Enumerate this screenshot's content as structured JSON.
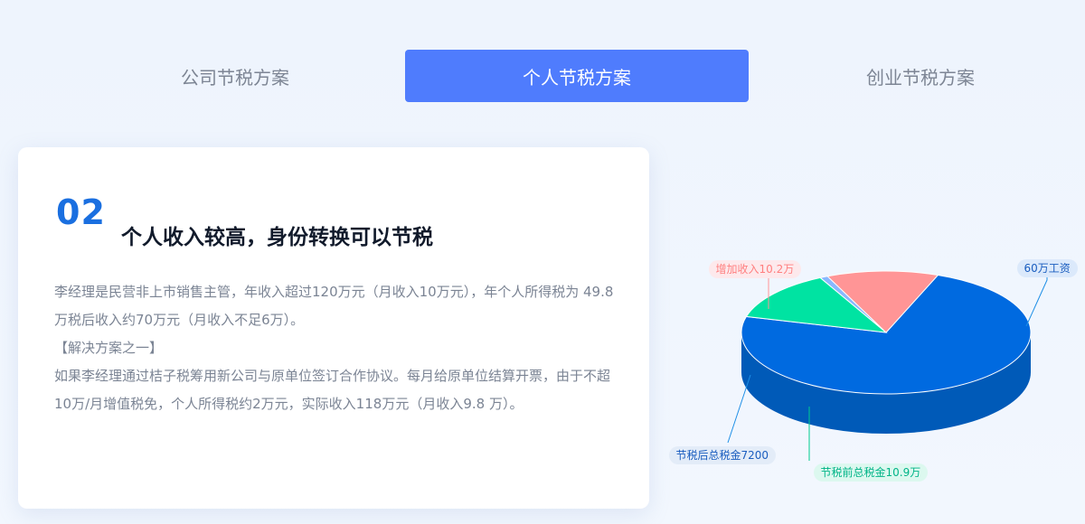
{
  "tabs": [
    {
      "label": "公司节税方案",
      "active": false
    },
    {
      "label": "个人节税方案",
      "active": true
    },
    {
      "label": "创业节税方案",
      "active": false
    }
  ],
  "card": {
    "number": "02",
    "title": "个人收入较高，身份转换可以节税",
    "paragraphs": [
      "李经理是民营非上市销售主管，年收入超过120万元（月收入10万元），年个人所得税为 49.8万税后收入约70万元（月收入不足6万）。",
      "【解决方案之一】",
      "如果李经理通过桔子税筹用新公司与原单位签订合作协议。每月给原单位结算开票，由于不超10万/月增值税免，个人所得税约2万元，实际收入118万元（月收入9.8 万）。"
    ]
  },
  "chart_data": {
    "type": "pie",
    "categories": [
      "60万工资",
      "节税前总税金10.9万",
      "节税后总税金7200",
      "增加收入10.2万"
    ],
    "values": [
      60,
      10.9,
      0.72,
      10.2
    ],
    "colors": {
      "slices": [
        "#006ae0",
        "#00e3a2",
        "#88b8ff",
        "#ff9596"
      ],
      "sides": [
        "#005ab8",
        "#00cc90",
        "#1ea8ff",
        "#ff9596"
      ],
      "labelText": [
        "#1a5dbf",
        "#00b487",
        "#1a5dbf",
        "#ff7f7f"
      ],
      "labelBg": [
        "#dbe9fb",
        "#dcf8ef",
        "#e3ecf8",
        "#fde9ec"
      ]
    }
  }
}
